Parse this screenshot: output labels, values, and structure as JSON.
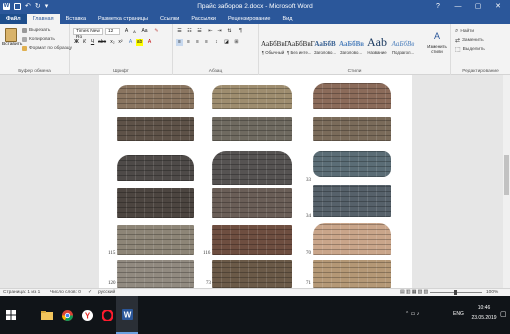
{
  "window": {
    "title": "Прайс заборов 2.docx - Microsoft Word",
    "controls": [
      "?",
      "—",
      "▢",
      "✕"
    ]
  },
  "ribbon_tabs": [
    "Файл",
    "Главная",
    "Вставка",
    "Разметка страницы",
    "Ссылки",
    "Рассылки",
    "Рецензирование",
    "Вид"
  ],
  "ribbon": {
    "clipboard": {
      "paste": "Вставить",
      "cut": "Вырезать",
      "copy": "Копировать",
      "format_painter": "Формат по образцу",
      "group": "Буфер обмена"
    },
    "font": {
      "name": "Times New Ro",
      "size": "12",
      "group": "Шрифт"
    },
    "paragraph": {
      "group": "Абзац"
    },
    "styles": {
      "group": "Стили",
      "items": [
        {
          "sample": "АаБбВвГ",
          "name": "¶ Обычный"
        },
        {
          "sample": "АаБбВвГ",
          "name": "¶ Без инте..."
        },
        {
          "sample": "АаБбВ",
          "name": "Заголово..."
        },
        {
          "sample": "АаБбВв",
          "name": "Заголово..."
        },
        {
          "sample": "Aab",
          "name": "Название"
        },
        {
          "sample": "АаБбВв",
          "name": "Подзагол..."
        }
      ],
      "change_styles": "Изменить стили"
    },
    "editing": {
      "find": "Найти",
      "replace": "Заменить",
      "select": "Выделить",
      "group": "Редактирование"
    }
  },
  "document": {
    "numbers": [
      "33",
      "34",
      "70",
      "115",
      "116",
      "120",
      "73",
      "71"
    ],
    "fence_colors": [
      "#8a7560",
      "#9e8d6f",
      "#8b6b5a",
      "#5e5248",
      "#6f6a60",
      "#7a6b5a",
      "#4e4a48",
      "#565352",
      "#5b6d76",
      "#4c4540",
      "#6a5e57",
      "#56616a",
      "#8d8577",
      "#6e4e40",
      "#c9a58a",
      "#918a80",
      "#6b5a48",
      "#b49876"
    ]
  },
  "status": {
    "page": "Страница: 1 из 1",
    "words": "Число слов: 0",
    "language": "русский",
    "zoom": "100%"
  },
  "taskbar": {
    "apps": [
      "windows-logo",
      "file-explorer",
      "chrome",
      "yandex",
      "opera",
      "word"
    ],
    "lang": "ENG",
    "time": "10:46",
    "date": "23.05.2019"
  }
}
